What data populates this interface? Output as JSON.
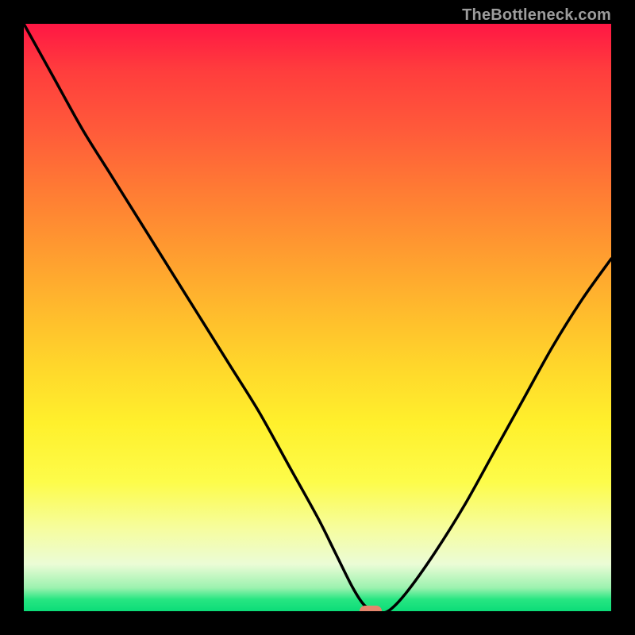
{
  "attribution": "TheBottleneck.com",
  "colors": {
    "frame": "#000000",
    "curve_stroke": "#000000",
    "marker_fill": "#e5866d"
  },
  "chart_data": {
    "type": "line",
    "title": "",
    "xlabel": "",
    "ylabel": "",
    "xlim": [
      0,
      100
    ],
    "ylim": [
      0,
      100
    ],
    "grid": false,
    "legend": false,
    "series": [
      {
        "name": "bottleneck-curve",
        "x": [
          0,
          5,
          10,
          15,
          20,
          25,
          30,
          35,
          40,
          45,
          50,
          53,
          56,
          58,
          60,
          62,
          65,
          70,
          75,
          80,
          85,
          90,
          95,
          100
        ],
        "values": [
          100,
          91,
          82,
          74,
          66,
          58,
          50,
          42,
          34,
          25,
          16,
          10,
          4,
          1,
          0,
          0,
          3,
          10,
          18,
          27,
          36,
          45,
          53,
          60
        ]
      }
    ],
    "marker": {
      "x": 59,
      "y": 0
    }
  }
}
